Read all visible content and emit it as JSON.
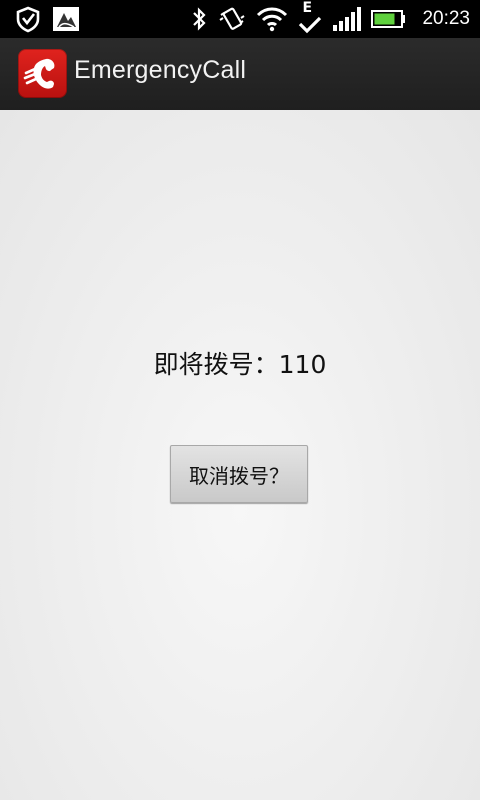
{
  "status_bar": {
    "time": "20:23",
    "icons": {
      "left": [
        "shield-icon",
        "notification-app-icon"
      ],
      "right": [
        "bluetooth-icon",
        "vibrate-icon",
        "wifi-icon",
        "data-e-icon",
        "signal-icon",
        "battery-icon"
      ]
    },
    "network_letter": "E",
    "battery_level": 0.8,
    "colors": {
      "battery": "#5fd13d"
    }
  },
  "action_bar": {
    "title": "EmergencyCall",
    "icon": "phone-call-app-icon",
    "colors": {
      "icon_bg": "#d41c18"
    }
  },
  "main": {
    "dial_text": "即将拨号：110",
    "cancel_label": "取消拨号？"
  }
}
